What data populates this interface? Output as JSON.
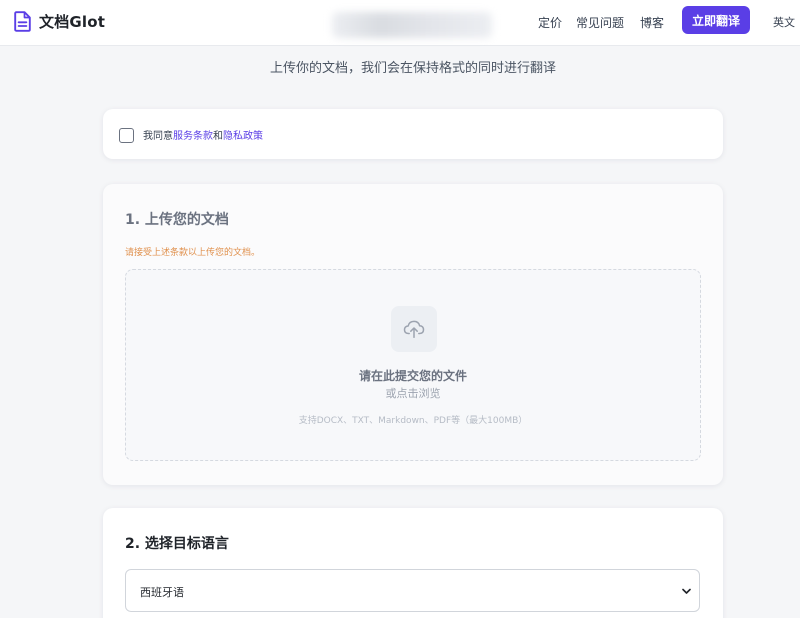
{
  "header": {
    "logo_text": "文档Glot",
    "logo_icon": "document-icon",
    "nav": {
      "pricing": "定价",
      "faq": "常见问题",
      "blog": "博客"
    },
    "cta_label": "立即翻译",
    "language": "英文"
  },
  "subtitle": "上传你的文档，我们会在保持格式的同时进行翻译",
  "terms": {
    "prefix": "我同意",
    "tos_link": "服务条款",
    "and": "和",
    "privacy_link": "隐私政策",
    "checked": false
  },
  "upload": {
    "title": "1. 上传您的文档",
    "warning": "请接受上述条款以上传您的文档。",
    "icon": "cloud-upload-icon",
    "main_text": "请在此提交您的文件",
    "sub_text": "或点击浏览",
    "formats": "支持DOCX、TXT、Markdown、PDF等（最大100MB）"
  },
  "target_language": {
    "title": "2. 选择目标语言",
    "selected": "西班牙语",
    "icon": "chevron-down-icon"
  },
  "colors": {
    "accent": "#5a3ee6",
    "warning": "#e0914e",
    "background": "#f5f6f8"
  }
}
